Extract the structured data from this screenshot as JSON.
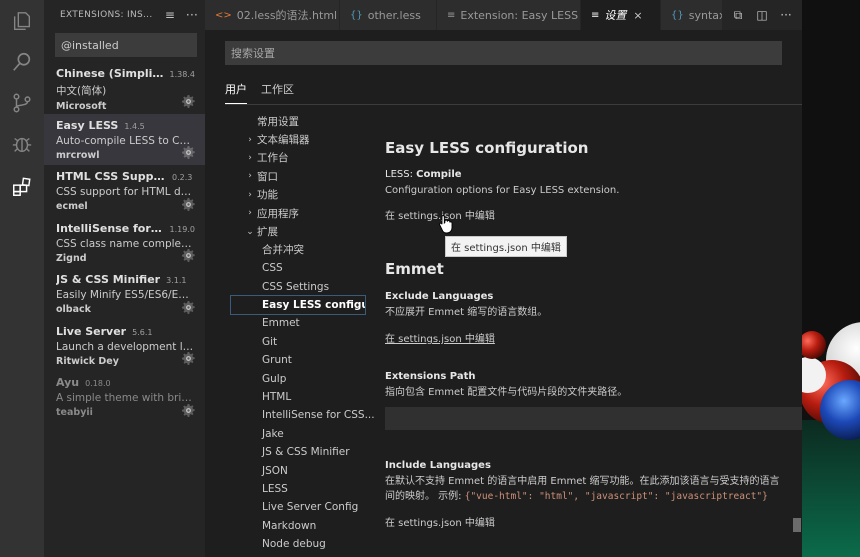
{
  "sidebar": {
    "title": "EXTENSIONS: INS...",
    "search_value": "@installed",
    "extensions": [
      {
        "name": "Chinese (Simplifie...",
        "version": "1.38.4",
        "desc": "中文(简体)",
        "publisher": "Microsoft"
      },
      {
        "name": "Easy LESS",
        "version": "1.4.5",
        "desc": "Auto-compile LESS to CSS ...",
        "publisher": "mrcrowl"
      },
      {
        "name": "HTML CSS Support",
        "version": "0.2.3",
        "desc": "CSS support for HTML doc...",
        "publisher": "ecmel"
      },
      {
        "name": "IntelliSense for CS...",
        "version": "1.19.0",
        "desc": "CSS class name completion...",
        "publisher": "Zignd"
      },
      {
        "name": "JS & CSS Minifier",
        "version": "3.1.1",
        "desc": "Easily Minify ES5/ES6/ES7/E...",
        "publisher": "olback"
      },
      {
        "name": "Live Server",
        "version": "5.6.1",
        "desc": "Launch a development loca...",
        "publisher": "Ritwick Dey"
      },
      {
        "name": "Ayu",
        "version": "0.18.0",
        "desc": "A simple theme with bright...",
        "publisher": "teabyii"
      }
    ]
  },
  "tabs": [
    {
      "icon": "<>",
      "label": "02.less的语法.html"
    },
    {
      "icon": "{}",
      "label": "other.less"
    },
    {
      "icon": "≡",
      "label": "Extension: Easy LESS"
    },
    {
      "icon": "≡",
      "label": "设置",
      "close": "×"
    },
    {
      "icon": "{}",
      "label": "syntax"
    }
  ],
  "settings": {
    "search_placeholder": "搜索设置",
    "scope_tabs": [
      "用户",
      "工作区"
    ],
    "toc": [
      {
        "label": "常用设置",
        "twisty": ""
      },
      {
        "label": "文本编辑器",
        "twisty": "›"
      },
      {
        "label": "工作台",
        "twisty": "›"
      },
      {
        "label": "窗口",
        "twisty": "›"
      },
      {
        "label": "功能",
        "twisty": "›"
      },
      {
        "label": "应用程序",
        "twisty": "›"
      },
      {
        "label": "扩展",
        "twisty": "⌄"
      }
    ],
    "toc_children": [
      "合并冲突",
      "CSS",
      "CSS Settings",
      "Easy LESS configu...",
      "Emmet",
      "Git",
      "Grunt",
      "Gulp",
      "HTML",
      "IntelliSense for CSS...",
      "Jake",
      "JS & CSS Minifier",
      "JSON",
      "LESS",
      "Live Server Config",
      "Markdown",
      "Node debug"
    ],
    "sections": {
      "easyless_title": "Easy LESS configuration",
      "compile_cat": "LESS: ",
      "compile_name": "Compile",
      "compile_desc": "Configuration options for Easy LESS extension.",
      "edit_link": "在 settings.json 中编辑",
      "tooltip": "在 settings.json 中编辑",
      "emmet_title": "Emmet",
      "exclude_title": "Exclude Languages",
      "exclude_desc": "不应展开 Emmet 缩写的语言数组。",
      "ext_path_title": "Extensions Path",
      "ext_path_desc": "指向包含 Emmet 配置文件与代码片段的文件夹路径。",
      "include_title": "Include Languages",
      "include_desc": "在默认不支持 Emmet 的语言中启用 Emmet 缩写功能。在此添加该语言与受支持的语言间的映射。 示例: ",
      "include_code": "{\"vue-html\": \"html\", \"javascript\": \"javascriptreact\"}"
    }
  }
}
